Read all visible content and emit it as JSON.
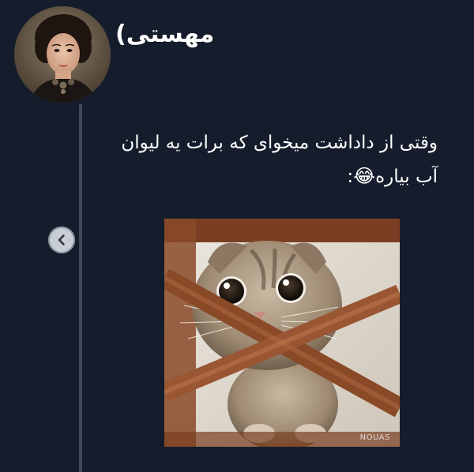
{
  "author": {
    "name": "مهستی)"
  },
  "post": {
    "line1": "وقتی از داداشت میخوای که برات یه لیوان",
    "line2": "آب بیاره",
    "emoji": "😂",
    "trailing": ":"
  },
  "photo": {
    "watermark": "NOUAS"
  },
  "icons": {
    "back": "chevron-left-icon"
  },
  "colors": {
    "background": "#151d2c",
    "thread_line": "#3d4b5c",
    "text": "#ffffff"
  }
}
